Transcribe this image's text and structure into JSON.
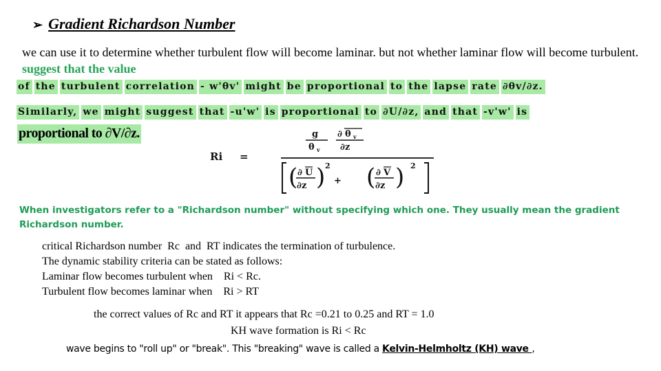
{
  "heading": {
    "bullet_icon": "arrow-bullet",
    "bullet_glyph": "➢",
    "title": "Gradient Richardson Number"
  },
  "intro": {
    "text": "we can use it to determine whether turbulent flow will become laminar. but not whether laminar flow will become turbulent.",
    "highlight": "suggest that the value"
  },
  "highlighted_excerpt": {
    "line1": [
      "of",
      "the",
      "turbulent",
      "correlation",
      "- w'θv'",
      "might",
      "be",
      "proportional",
      "to",
      "the",
      "lapse",
      "rate",
      "∂θv/∂z."
    ],
    "line2": [
      "Similarly,",
      "we",
      "might",
      "suggest",
      "that",
      "-u'w'",
      "is",
      "proportional",
      "to",
      "∂U/∂z,",
      "and",
      "that",
      "-v'w'",
      "is"
    ],
    "line3": "proportional to ∂V/∂z."
  },
  "formula": {
    "lhs": "Ri",
    "equals": "=",
    "numerator_g": "g",
    "numerator_theta": "θ",
    "numerator_sub": "v",
    "partial": "∂",
    "dz": "∂z",
    "U": "U",
    "V": "V",
    "exp": "2",
    "plus": "+"
  },
  "green_note": "When investigators refer to a \"Richardson number\" without specifying which one. They usually mean the gradient Richardson number.",
  "criteria": [
    "critical Richardson number  Rc  and  RT indicates the termination of turbulence.",
    "The dynamic stability criteria can be stated as follows:",
    "Laminar flow becomes turbulent when    Ri < Rc.",
    "Turbulent flow becomes laminar when    Ri > RT"
  ],
  "values": {
    "line1": "the correct values of Rc and RT it appears that Rc =0.21 to 0.25 and RT = 1.0",
    "line2": "KH wave formation is Ri < Rc"
  },
  "kh": {
    "prefix": "wave begins to \"roll up\" or \"break\". This \"breaking\" wave is called a ",
    "term": "Kelvin-Helmholtz (KH) wave ",
    "suffix": ","
  }
}
